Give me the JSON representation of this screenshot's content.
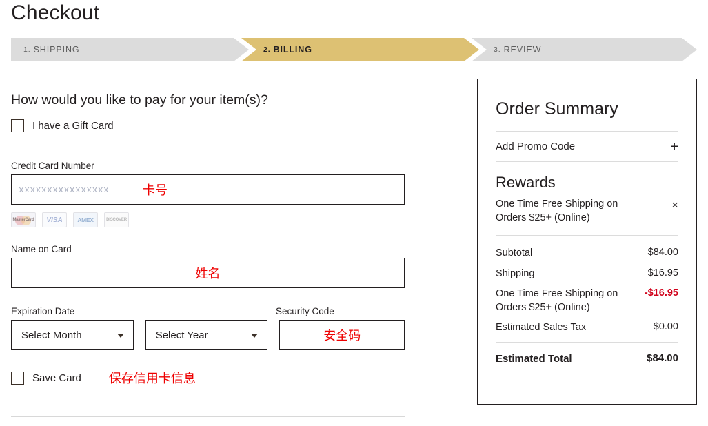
{
  "page": {
    "title": "Checkout"
  },
  "steps": [
    {
      "num": "1.",
      "label": "SHIPPING",
      "state": "complete"
    },
    {
      "num": "2.",
      "label": "BILLING",
      "state": "active"
    },
    {
      "num": "3.",
      "label": "REVIEW",
      "state": "upcoming"
    }
  ],
  "payment": {
    "question": "How would you like to pay for your item(s)?",
    "gift_card_label": "I have a Gift Card",
    "card_number_label": "Credit Card Number",
    "card_number_placeholder": "xxxxxxxxxxxxxxxx",
    "card_number_note": "卡号",
    "name_on_card_label": "Name on Card",
    "name_on_card_note": "姓名",
    "expiration_label": "Expiration Date",
    "month_value": "Select Month",
    "year_value": "Select Year",
    "security_code_label": "Security Code",
    "security_code_note": "安全码",
    "save_card_label": "Save Card",
    "save_card_note": "保存信用卡信息",
    "accepted_cards": [
      {
        "name": "mastercard-logo",
        "text": "MasterCard"
      },
      {
        "name": "visa-logo",
        "text": "VISA"
      },
      {
        "name": "amex-logo",
        "text": "AMEX"
      },
      {
        "name": "discover-logo",
        "text": "DISCOVER"
      }
    ]
  },
  "summary": {
    "title": "Order Summary",
    "promo_label": "Add Promo Code",
    "promo_icon": "+",
    "rewards_title": "Rewards",
    "reward_item": "One Time Free Shipping on Orders $25+ (Online)",
    "reward_remove_icon": "×",
    "lines": [
      {
        "label": "Subtotal",
        "value": "$84.00",
        "negative": false
      },
      {
        "label": "Shipping",
        "value": "$16.95",
        "negative": false
      },
      {
        "label": "One Time Free Shipping on Orders $25+ (Online)",
        "value": "-$16.95",
        "negative": true
      },
      {
        "label": "Estimated Sales Tax",
        "value": "$0.00",
        "negative": false
      }
    ],
    "total_label": "Estimated Total",
    "total_value": "$84.00"
  },
  "colors": {
    "active_step": "#ddc173",
    "inactive_step": "#dcdcdc",
    "text": "#231f20",
    "annotation": "#ee0000",
    "discount": "#d0021b"
  }
}
